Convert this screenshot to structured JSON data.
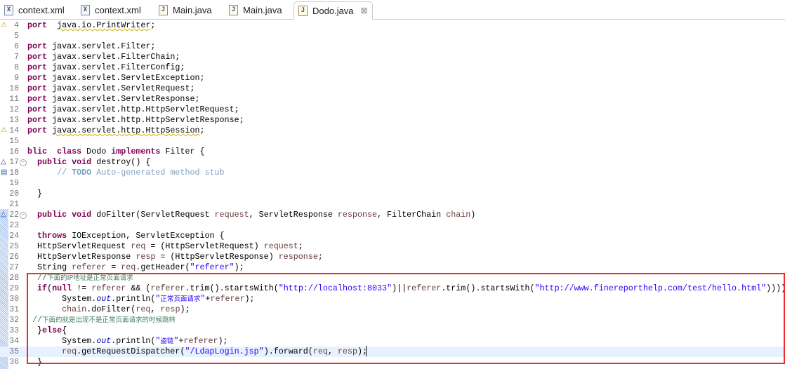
{
  "tabs": [
    {
      "label": "context.xml",
      "icon": "xml-file-icon",
      "active": false
    },
    {
      "label": "context.xml",
      "icon": "xml-file-icon",
      "active": false
    },
    {
      "label": "Main.java",
      "icon": "java-file-icon",
      "active": false
    },
    {
      "label": "Main.java",
      "icon": "java-file-icon",
      "active": false
    },
    {
      "label": "Dodo.java",
      "icon": "java-file-warning-icon",
      "active": true,
      "close": "⊠"
    }
  ],
  "editor": {
    "current_line": 35,
    "lines": [
      {
        "n": "4",
        "marker": "warning-icon",
        "t": [
          [
            "kw",
            "port"
          ],
          [
            "",
            "  "
          ],
          [
            "warn",
            "java.io.PrintWriter"
          ],
          [
            "",
            ";"
          ]
        ]
      },
      {
        "n": "5",
        "t": []
      },
      {
        "n": "6",
        "t": [
          [
            "kw",
            "port"
          ],
          [
            "",
            " javax.servlet.Filter;"
          ]
        ]
      },
      {
        "n": "7",
        "t": [
          [
            "kw",
            "port"
          ],
          [
            "",
            " javax.servlet.FilterChain;"
          ]
        ]
      },
      {
        "n": "8",
        "t": [
          [
            "kw",
            "port"
          ],
          [
            "",
            " javax.servlet.FilterConfig;"
          ]
        ]
      },
      {
        "n": "9",
        "t": [
          [
            "kw",
            "port"
          ],
          [
            "",
            " javax.servlet.ServletException;"
          ]
        ]
      },
      {
        "n": "10",
        "t": [
          [
            "kw",
            "port"
          ],
          [
            "",
            " javax.servlet.ServletRequest;"
          ]
        ]
      },
      {
        "n": "11",
        "t": [
          [
            "kw",
            "port"
          ],
          [
            "",
            " javax.servlet.ServletResponse;"
          ]
        ]
      },
      {
        "n": "12",
        "t": [
          [
            "kw",
            "port"
          ],
          [
            "",
            " javax.servlet.http.HttpServletRequest;"
          ]
        ]
      },
      {
        "n": "13",
        "t": [
          [
            "kw",
            "port"
          ],
          [
            "",
            " javax.servlet.http.HttpServletResponse;"
          ]
        ]
      },
      {
        "n": "14",
        "marker": "warning-icon",
        "t": [
          [
            "kw",
            "port"
          ],
          [
            "",
            " "
          ],
          [
            "warn",
            "javax.servlet.http.HttpSession"
          ],
          [
            "",
            ";"
          ]
        ]
      },
      {
        "n": "15",
        "t": []
      },
      {
        "n": "16",
        "t": [
          [
            "kw",
            "blic"
          ],
          [
            "",
            "  "
          ],
          [
            "kw",
            "class"
          ],
          [
            "",
            " Dodo "
          ],
          [
            "kw",
            "implements"
          ],
          [
            "",
            " Filter {"
          ]
        ]
      },
      {
        "n": "17",
        "marker": "override-icon",
        "fold": true,
        "t": [
          [
            "",
            "  "
          ],
          [
            "kw",
            "public"
          ],
          [
            "",
            " "
          ],
          [
            "kw",
            "void"
          ],
          [
            "",
            " destroy() {"
          ]
        ]
      },
      {
        "n": "18",
        "marker": "task-icon",
        "t": [
          [
            "",
            "      "
          ],
          [
            "todoc",
            "// "
          ],
          [
            "todo",
            "TODO"
          ],
          [
            "todoc",
            " Auto-generated method stub"
          ]
        ]
      },
      {
        "n": "19",
        "t": []
      },
      {
        "n": "20",
        "t": [
          [
            "",
            "  }"
          ]
        ]
      },
      {
        "n": "21",
        "t": []
      },
      {
        "n": "22",
        "marker": "override-icon",
        "fold": true,
        "t": [
          [
            "",
            "  "
          ],
          [
            "kw",
            "public"
          ],
          [
            "",
            " "
          ],
          [
            "kw",
            "void"
          ],
          [
            "",
            " doFilter(ServletRequest "
          ],
          [
            "var",
            "request"
          ],
          [
            "",
            ", ServletResponse "
          ],
          [
            "var",
            "response"
          ],
          [
            "",
            ", FilterChain "
          ],
          [
            "var",
            "chain"
          ],
          [
            "",
            ")"
          ]
        ]
      },
      {
        "n": "23",
        "t": []
      },
      {
        "n": "24",
        "t": [
          [
            "",
            "  "
          ],
          [
            "kw",
            "throws"
          ],
          [
            "",
            " IOException, ServletException {"
          ]
        ]
      },
      {
        "n": "25",
        "t": [
          [
            "",
            "  HttpServletRequest "
          ],
          [
            "var",
            "req"
          ],
          [
            "",
            " = (HttpServletRequest) "
          ],
          [
            "var",
            "request"
          ],
          [
            "",
            ";"
          ]
        ]
      },
      {
        "n": "26",
        "t": [
          [
            "",
            "  HttpServletResponse "
          ],
          [
            "var",
            "resp"
          ],
          [
            "",
            " = (HttpServletResponse) "
          ],
          [
            "var",
            "response"
          ],
          [
            "",
            ";"
          ]
        ]
      },
      {
        "n": "27",
        "t": [
          [
            "",
            "  String "
          ],
          [
            "var",
            "referer"
          ],
          [
            "",
            " = "
          ],
          [
            "var",
            "req"
          ],
          [
            "",
            ".getHeader("
          ],
          [
            "str",
            "\"referer\""
          ],
          [
            "",
            ");"
          ]
        ]
      },
      {
        "n": "28",
        "t": [
          [
            "",
            "  "
          ],
          [
            "cmt",
            "//"
          ],
          [
            "cmtcn",
            "下面的IP地址是正常页面请求"
          ]
        ]
      },
      {
        "n": "29",
        "t": [
          [
            "",
            "  "
          ],
          [
            "kw",
            "if"
          ],
          [
            "",
            "("
          ],
          [
            "kw",
            "null"
          ],
          [
            "",
            " != "
          ],
          [
            "var",
            "referer"
          ],
          [
            "",
            " && ("
          ],
          [
            "var",
            "referer"
          ],
          [
            "",
            ".trim().startsWith("
          ],
          [
            "str",
            "\"http://localhost:8033\""
          ],
          [
            "",
            ")||"
          ],
          [
            "var",
            "referer"
          ],
          [
            "",
            ".trim().startsWith("
          ],
          [
            "str",
            "\"http://www.finereporthelp.com/test/hello.html\""
          ],
          [
            "",
            ")))){"
          ]
        ]
      },
      {
        "n": "30",
        "t": [
          [
            "",
            "       System."
          ],
          [
            "fld",
            "out"
          ],
          [
            "",
            ".println("
          ],
          [
            "str",
            "\""
          ],
          [
            "strcn",
            "正常页面请求"
          ],
          [
            "str",
            "\""
          ],
          [
            "",
            "+"
          ],
          [
            "var",
            "referer"
          ],
          [
            "",
            ");"
          ]
        ]
      },
      {
        "n": "31",
        "t": [
          [
            "",
            "       "
          ],
          [
            "var",
            "chain"
          ],
          [
            "",
            ".doFilter("
          ],
          [
            "var",
            "req"
          ],
          [
            "",
            ", "
          ],
          [
            "var",
            "resp"
          ],
          [
            "",
            ");"
          ]
        ]
      },
      {
        "n": "32",
        "t": [
          [
            "",
            " "
          ],
          [
            "cmt",
            "//"
          ],
          [
            "cmtcn",
            "下面的就是出现不是正常页面请求的时候跳转"
          ]
        ]
      },
      {
        "n": "33",
        "t": [
          [
            "",
            "  }"
          ],
          [
            "kw",
            "else"
          ],
          [
            "",
            "{"
          ]
        ]
      },
      {
        "n": "34",
        "t": [
          [
            "",
            "       System."
          ],
          [
            "fld",
            "out"
          ],
          [
            "",
            ".println("
          ],
          [
            "str",
            "\""
          ],
          [
            "strcn",
            "盗链"
          ],
          [
            "str",
            "\""
          ],
          [
            "",
            "+"
          ],
          [
            "var",
            "referer"
          ],
          [
            "",
            ");"
          ]
        ]
      },
      {
        "n": "35",
        "t": [
          [
            "",
            "       "
          ],
          [
            "var",
            "req"
          ],
          [
            "",
            ".getRequestDispatcher("
          ],
          [
            "str",
            "\"/LdapLogin.jsp\""
          ],
          [
            "",
            ").forward("
          ],
          [
            "var",
            "req"
          ],
          [
            "",
            ", "
          ],
          [
            "var",
            "resp"
          ],
          [
            "",
            ");"
          ]
        ]
      },
      {
        "n": "36",
        "t": [
          [
            "",
            "  }"
          ]
        ]
      }
    ]
  }
}
